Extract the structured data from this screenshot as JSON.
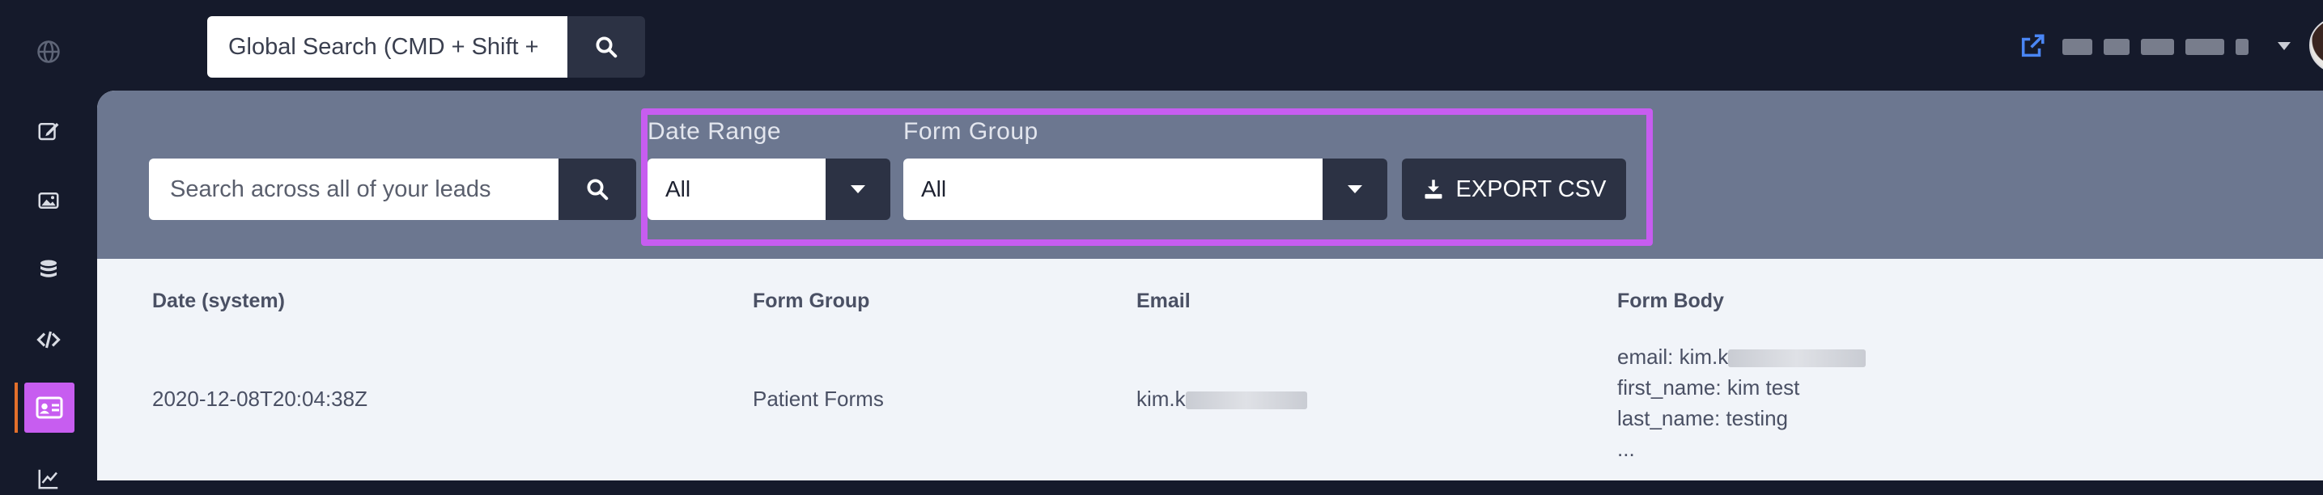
{
  "topbar": {
    "global_search_placeholder": "Global Search (CMD + Shift +",
    "search_icon": "search-icon",
    "external_link_icon": "external-link-icon"
  },
  "sidebar": {
    "items": [
      {
        "icon": "globe-icon"
      },
      {
        "icon": "edit-icon"
      },
      {
        "icon": "image-icon"
      },
      {
        "icon": "database-icon"
      },
      {
        "icon": "code-icon"
      },
      {
        "icon": "id-card-icon",
        "active": true
      },
      {
        "icon": "chart-icon"
      }
    ],
    "active_color": "#c75df0"
  },
  "filters": {
    "lead_search_placeholder": "Search across all of your leads",
    "date_range_label": "Date Range",
    "date_range_value": "All",
    "form_group_label": "Form Group",
    "form_group_value": "All",
    "export_label": "EXPORT CSV"
  },
  "table": {
    "headers": [
      "Date (system)",
      "Form Group",
      "Email",
      "Form Body"
    ],
    "rows": [
      {
        "date": "2020-12-08T20:04:38Z",
        "form_group": "Patient Forms",
        "email": "kim.k",
        "body": [
          "email: kim.k",
          "first_name: kim test",
          "last_name: testing",
          "..."
        ]
      }
    ]
  },
  "colors": {
    "background": "#151a2b",
    "filter_bar": "#6c7790",
    "button": "#2c3244",
    "highlight": "#c75df0"
  }
}
